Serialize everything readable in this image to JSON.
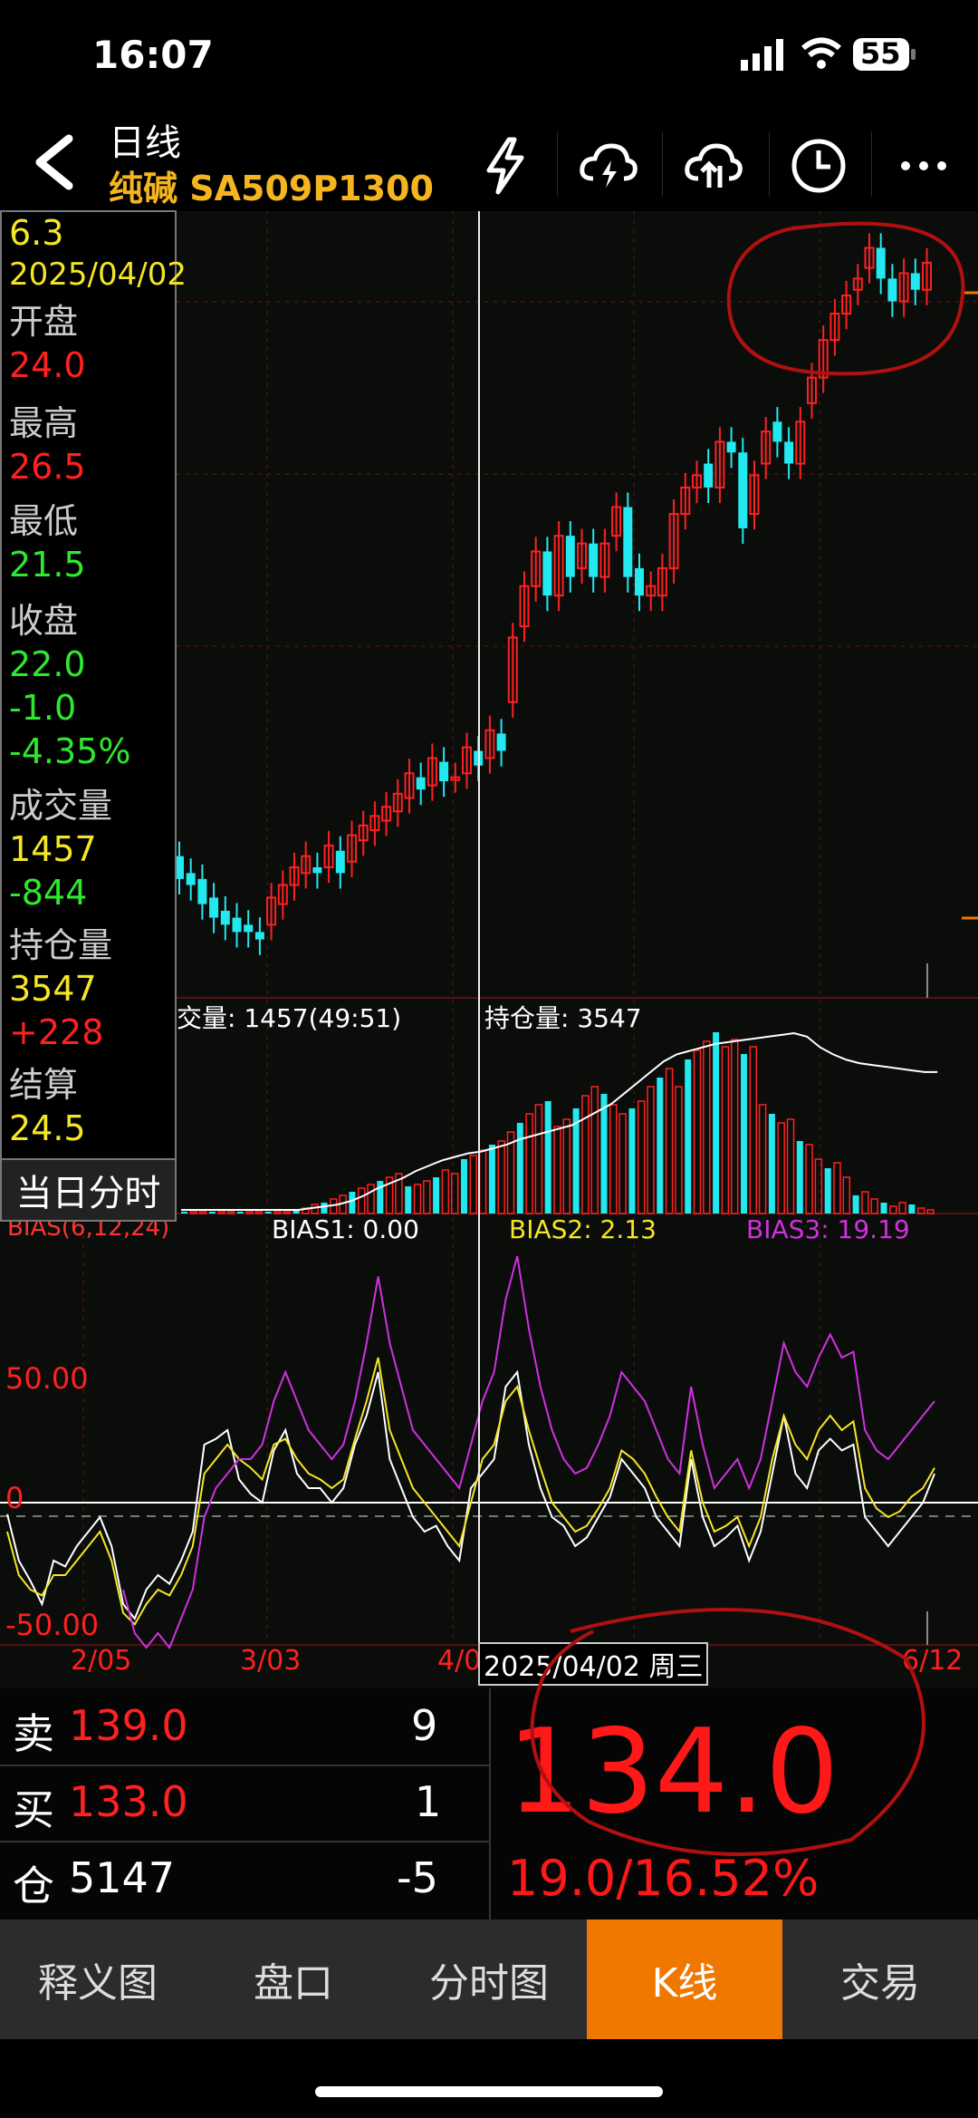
{
  "status": {
    "time": "16:07",
    "battery": "55"
  },
  "header": {
    "title": "日线",
    "subtitle": "纯碱 SA509P1300"
  },
  "info": {
    "price": "6.3",
    "date": "2025/04/02",
    "open_label": "开盘",
    "open": "24.0",
    "high_label": "最高",
    "high": "26.5",
    "low_label": "最低",
    "low": "21.5",
    "close_label": "收盘",
    "close": "22.0",
    "change": "-1.0",
    "change_pct": "-4.35%",
    "volume_label": "成交量",
    "volume": "1457",
    "volume_change": "-844",
    "oi_label": "持仓量",
    "oi": "3547",
    "oi_change": "+228",
    "settle_label": "结算",
    "settle": "24.5",
    "intraday_button": "当日分时"
  },
  "volume_panel": {
    "volume_label": "交量: 1457(49:51)",
    "oi_label": "持仓量: 3547"
  },
  "bias_panel": {
    "title": "BIAS(6,12,24)",
    "bias1": "BIAS1: 0.00",
    "bias2": "BIAS2: 2.13",
    "bias3": "BIAS3: 19.19",
    "tick_top": "50.00",
    "tick_mid": "0",
    "tick_bottom": "-50.00"
  },
  "x_axis": {
    "ticks": [
      "2/05",
      "3/03",
      "4/0",
      "6/12"
    ],
    "cursor_label": "2025/04/02 周三"
  },
  "quote": {
    "sell_label": "卖",
    "sell_price": "139.0",
    "sell_qty": "9",
    "buy_label": "买",
    "buy_price": "133.0",
    "buy_qty": "1",
    "oi_label": "仓",
    "oi_value": "5147",
    "oi_change": "-5",
    "last_price": "134.0",
    "change": "19.0/16.52%"
  },
  "tabs": [
    "释义图",
    "盘口",
    "分时图",
    "K线",
    "交易"
  ],
  "active_tab": "K线",
  "colors": {
    "up": "#ff2020",
    "down": "#22e8f0",
    "accent": "#f07800",
    "yellow": "#f5e625",
    "magenta": "#d030e0",
    "green": "#2ee82e"
  },
  "chart_data": [
    {
      "type": "candlestick",
      "title": "",
      "candles_approx_price": [
        {
          "o": 4.6,
          "c": 4.2
        },
        {
          "o": 4.3,
          "c": 4.1
        },
        {
          "o": 4.2,
          "c": 3.8
        },
        {
          "o": 3.9,
          "c": 3.6
        },
        {
          "o": 3.7,
          "c": 3.5
        },
        {
          "o": 3.6,
          "c": 3.4
        },
        {
          "o": 3.5,
          "c": 3.4
        },
        {
          "o": 3.4,
          "c": 3.3
        },
        {
          "o": 3.5,
          "c": 3.9
        },
        {
          "o": 3.8,
          "c": 4.1
        },
        {
          "o": 4.1,
          "c": 4.4
        },
        {
          "o": 4.3,
          "c": 4.6
        },
        {
          "o": 4.4,
          "c": 4.3
        },
        {
          "o": 4.4,
          "c": 4.8
        },
        {
          "o": 4.7,
          "c": 4.3
        },
        {
          "o": 4.5,
          "c": 5.0
        },
        {
          "o": 4.9,
          "c": 5.2
        },
        {
          "o": 5.1,
          "c": 5.4
        },
        {
          "o": 5.3,
          "c": 5.6
        },
        {
          "o": 5.5,
          "c": 5.9
        },
        {
          "o": 5.8,
          "c": 6.4
        },
        {
          "o": 6.3,
          "c": 6.0
        },
        {
          "o": 6.1,
          "c": 6.8
        },
        {
          "o": 6.7,
          "c": 6.2
        },
        {
          "o": 6.3,
          "c": 6.3
        },
        {
          "o": 6.4,
          "c": 7.1
        },
        {
          "o": 7.0,
          "c": 6.6
        },
        {
          "o": 6.8,
          "c": 7.6
        },
        {
          "o": 7.5,
          "c": 7.0
        },
        {
          "o": 8.5,
          "c": 11.0
        },
        {
          "o": 11.5,
          "c": 13.5
        },
        {
          "o": 13.5,
          "c": 15.5
        },
        {
          "o": 15.5,
          "c": 13.0
        },
        {
          "o": 13.0,
          "c": 16.5
        },
        {
          "o": 16.5,
          "c": 14.0
        },
        {
          "o": 14.5,
          "c": 16.0
        },
        {
          "o": 16.0,
          "c": 14.0
        },
        {
          "o": 14.0,
          "c": 16.0
        },
        {
          "o": 16.5,
          "c": 18.5
        },
        {
          "o": 18.5,
          "c": 14.0
        },
        {
          "o": 14.5,
          "c": 13.0
        },
        {
          "o": 13.0,
          "c": 13.5
        },
        {
          "o": 13.0,
          "c": 14.5
        },
        {
          "o": 14.5,
          "c": 18.0
        },
        {
          "o": 18.0,
          "c": 20.0
        },
        {
          "o": 20.0,
          "c": 21.0
        },
        {
          "o": 22.0,
          "c": 20.0
        },
        {
          "o": 20.0,
          "c": 24.0
        },
        {
          "o": 24.0,
          "c": 23.0
        },
        {
          "o": 23.0,
          "c": 17.0
        },
        {
          "o": 18.0,
          "c": 21.0
        },
        {
          "o": 22.0,
          "c": 25.0
        },
        {
          "o": 26.0,
          "c": 24.0
        },
        {
          "o": 24.0,
          "c": 22.0
        },
        {
          "o": 22.0,
          "c": 26.0
        },
        {
          "o": 28.0,
          "c": 31.0
        },
        {
          "o": 31.0,
          "c": 36.0
        },
        {
          "o": 36.0,
          "c": 40.0
        },
        {
          "o": 40.0,
          "c": 43.0
        },
        {
          "o": 44.0,
          "c": 46.0
        },
        {
          "o": 48.0,
          "c": 52.0
        },
        {
          "o": 52.0,
          "c": 46.0
        },
        {
          "o": 46.0,
          "c": 42.0
        },
        {
          "o": 42.0,
          "c": 47.0
        },
        {
          "o": 47.0,
          "c": 44.0
        },
        {
          "o": 44.0,
          "c": 49.0
        }
      ]
    },
    {
      "type": "bar+line",
      "series": [
        {
          "values_volume": [
            1,
            1,
            1,
            1,
            1,
            1,
            1,
            1,
            1,
            1,
            1,
            1,
            2,
            3,
            5,
            6,
            8,
            10,
            12,
            14,
            16,
            18,
            20,
            22,
            15,
            16,
            18,
            20,
            24,
            22,
            30,
            32,
            35,
            38,
            40,
            45,
            50,
            55,
            60,
            62,
            48,
            52,
            58,
            65,
            70,
            66,
            60,
            55,
            58,
            62,
            70,
            75,
            80,
            70,
            85,
            90,
            95,
            100,
            92,
            96,
            88,
            92,
            60,
            55,
            50,
            52,
            40,
            38,
            30,
            25,
            28,
            20,
            10,
            12,
            8,
            6,
            4,
            6,
            5,
            3,
            2
          ]
        },
        {
          "values_oi": [
            0,
            0,
            0,
            0,
            0,
            0,
            0,
            0,
            0,
            0,
            1,
            2,
            3,
            5,
            8,
            12,
            15,
            18,
            22,
            25,
            28,
            30,
            32,
            33,
            35,
            37,
            40,
            42,
            44,
            46,
            48,
            52,
            56,
            60,
            66,
            72,
            78,
            84,
            88,
            90,
            92,
            94,
            95,
            96,
            97,
            98,
            99,
            100,
            98,
            92,
            88,
            85,
            83,
            82,
            81,
            80,
            79,
            78,
            78
          ]
        }
      ]
    },
    {
      "type": "line",
      "ylim": [
        -60,
        100
      ],
      "series": [
        {
          "name": "BIAS1",
          "values": [
            -4,
            -20,
            -27,
            -35,
            -20,
            -22,
            -15,
            -10,
            -5,
            -15,
            -35,
            -40,
            -30,
            -25,
            -28,
            -20,
            -10,
            20,
            22,
            25,
            8,
            3,
            0,
            18,
            25,
            10,
            5,
            5,
            0,
            5,
            20,
            30,
            45,
            15,
            5,
            -5,
            -10,
            -8,
            -15,
            -20,
            5,
            10,
            15,
            40,
            45,
            20,
            5,
            -5,
            -8,
            -15,
            -12,
            -5,
            2,
            15,
            10,
            5,
            -5,
            -10,
            -15,
            15,
            -5,
            -15,
            -12,
            -8,
            -20,
            -10,
            10,
            30,
            10,
            5,
            18,
            22,
            18,
            20,
            -5,
            -10,
            -15,
            -10,
            -5,
            0,
            10
          ]
        },
        {
          "name": "BIAS2",
          "values": [
            -10,
            -25,
            -30,
            -32,
            -25,
            -25,
            -20,
            -15,
            -10,
            -20,
            -38,
            -42,
            -35,
            -30,
            -32,
            -25,
            -15,
            10,
            15,
            20,
            15,
            12,
            8,
            20,
            22,
            15,
            10,
            8,
            5,
            8,
            22,
            35,
            50,
            25,
            15,
            5,
            0,
            -5,
            -10,
            -15,
            0,
            15,
            20,
            35,
            40,
            25,
            12,
            0,
            -5,
            -10,
            -8,
            -2,
            5,
            18,
            15,
            10,
            2,
            -5,
            -10,
            18,
            0,
            -10,
            -8,
            -5,
            -15,
            -5,
            15,
            30,
            20,
            15,
            25,
            30,
            25,
            28,
            5,
            -2,
            -5,
            -3,
            2,
            5,
            12
          ]
        },
        {
          "name": "BIAS3",
          "values": [
            null,
            null,
            null,
            null,
            null,
            null,
            null,
            null,
            null,
            null,
            -30,
            -45,
            -50,
            -45,
            -50,
            -40,
            -30,
            -5,
            5,
            10,
            15,
            15,
            20,
            35,
            45,
            35,
            25,
            20,
            15,
            20,
            35,
            55,
            78,
            55,
            40,
            25,
            20,
            15,
            10,
            5,
            20,
            35,
            45,
            70,
            85,
            60,
            40,
            25,
            15,
            10,
            12,
            20,
            30,
            45,
            40,
            35,
            25,
            15,
            10,
            40,
            20,
            5,
            10,
            15,
            5,
            15,
            35,
            55,
            45,
            40,
            50,
            58,
            50,
            52,
            25,
            18,
            15,
            20,
            25,
            30,
            35
          ]
        }
      ]
    }
  ]
}
